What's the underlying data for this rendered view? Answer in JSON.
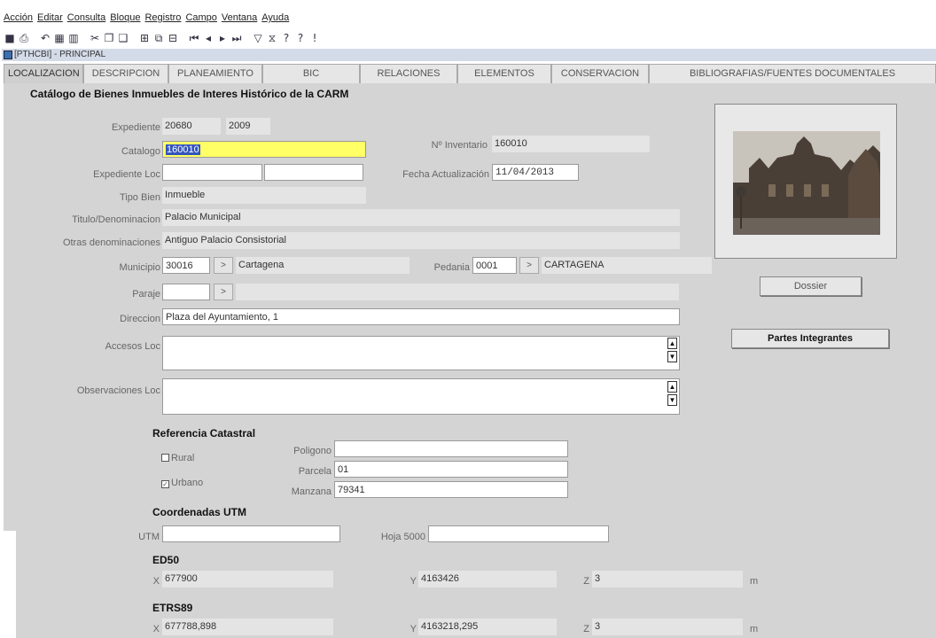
{
  "menu": [
    "Acción",
    "Editar",
    "Consulta",
    "Bloque",
    "Registro",
    "Campo",
    "Ventana",
    "Ayuda"
  ],
  "toolbar": [
    "save-icon",
    "print-icon",
    "rollback-icon",
    "calculator-icon",
    "query-icon",
    "cut-icon",
    "copy-icon",
    "paste-icon",
    "insert-record-icon",
    "duplicate-record-icon",
    "delete-record-icon",
    "first-record-icon",
    "previous-record-icon",
    "next-record-icon",
    "last-record-icon",
    "enter-query-icon",
    "cancel-query-icon",
    "help-icon",
    "help-topics-icon",
    "alert-icon"
  ],
  "window": {
    "title": "[PTHCBI] - PRINCIPAL"
  },
  "tabs": [
    "LOCALIZACION",
    "DESCRIPCION",
    "PLANEAMIENTO",
    "BIC",
    "RELACIONES",
    "ELEMENTOS",
    "CONSERVACION",
    "BIBLIOGRAFIAS/FUENTES DOCUMENTALES"
  ],
  "form": {
    "section_title": "Catálogo de Bienes Inmuebles de Interes Histórico de la CARM",
    "expediente": {
      "label": "Expediente",
      "number": "20680",
      "year": "2009"
    },
    "catalogo": {
      "label": "Catalogo",
      "value": "160010"
    },
    "inventario": {
      "label": "Nº Inventario",
      "value": "160010"
    },
    "expediente_loc": {
      "label": "Expediente Loc",
      "value1": "",
      "value2": ""
    },
    "fecha_actualizacion": {
      "label": "Fecha Actualización",
      "value": "11/04/2013"
    },
    "tipo_bien": {
      "label": "Tipo Bien",
      "value": "Inmueble"
    },
    "titulo": {
      "label": "Titulo/Denominacion",
      "value": "Palacio Municipal"
    },
    "otras": {
      "label": "Otras denominaciones",
      "value": "Antiguo Palacio Consistorial"
    },
    "municipio": {
      "label": "Municipio",
      "code": "30016",
      "button": ">",
      "name": "Cartagena"
    },
    "pedania": {
      "label": "Pedania",
      "code": "0001",
      "button": ">",
      "name": "CARTAGENA"
    },
    "paraje": {
      "label": "Paraje",
      "code": "",
      "button": ">",
      "name": ""
    },
    "direccion": {
      "label": "Direccion",
      "value": "Plaza del Ayuntamiento, 1"
    },
    "accesos": {
      "label": "Accesos Loc",
      "value": ""
    },
    "observaciones": {
      "label": "Observaciones Loc",
      "value": ""
    }
  },
  "side": {
    "dossier_label": "Dossier",
    "partes_label": "Partes Integrantes"
  },
  "catastral": {
    "title": "Referencia Catastral",
    "rural_label": "Rural",
    "rural_checked": false,
    "urbano_label": "Urbano",
    "urbano_checked": true,
    "poligono": {
      "label": "Poligono",
      "value": ""
    },
    "parcela": {
      "label": "Parcela",
      "value": "01"
    },
    "manzana": {
      "label": "Manzana",
      "value": "79341"
    }
  },
  "utm": {
    "title": "Coordenadas UTM",
    "utm_label": "UTM",
    "utm_value": "",
    "hoja_label": "Hoja 5000",
    "hoja_value": ""
  },
  "ed50": {
    "title": "ED50",
    "x_label": "X",
    "x": "677900",
    "y_label": "Y",
    "y": "4163426",
    "z_label": "Z",
    "z": "3",
    "unit": "m"
  },
  "etrs89": {
    "title": "ETRS89",
    "x_label": "X",
    "x": "677788,898",
    "y_label": "Y",
    "y": "4163218,295",
    "z_label": "Z",
    "z": "3",
    "unit": "m"
  }
}
